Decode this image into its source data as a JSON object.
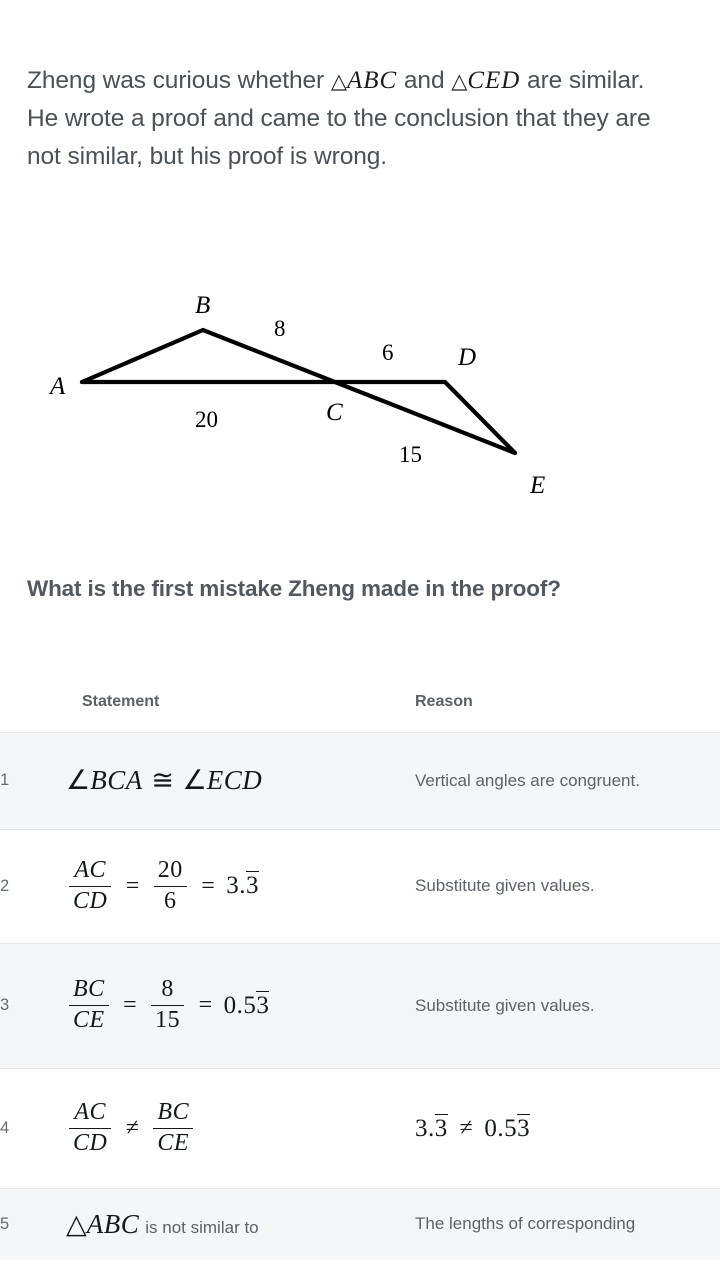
{
  "prompt": {
    "part1": "Zheng was curious whether ",
    "tri_abc": "△ABC",
    "part2": " and ",
    "tri_ced": "△CED",
    "part3": " are similar. He wrote a proof and came to the conclusion that they are not similar, but his proof is wrong."
  },
  "diagram": {
    "labels": {
      "A": "A",
      "B": "B",
      "C": "C",
      "D": "D",
      "E": "E"
    },
    "measures": {
      "ac": "20",
      "bc": "8",
      "cd": "6",
      "ce": "15"
    },
    "stroke_color": "#000000"
  },
  "question": "What is the first mistake Zheng made in the proof?",
  "table": {
    "headers": {
      "number": "",
      "statement": "Statement",
      "reason": "Reason"
    },
    "rows": [
      {
        "number": "1",
        "statement_text": "∠BCA ≅ ∠ECD",
        "statement_parts": {
          "angle1": "∠BCA",
          "congruent": "≅",
          "angle2": "∠ECD"
        },
        "reason": "Vertical angles are congruent."
      },
      {
        "number": "2",
        "statement_text": "AC/CD = 20/6 = 3.3̄",
        "statement_parts": {
          "frac1_top": "AC",
          "frac1_bot": "CD",
          "eq1": "=",
          "frac2_top": "20",
          "frac2_bot": "6",
          "eq2": "=",
          "value_lead": "3.",
          "value_repeat": "3"
        },
        "reason": "Substitute given values."
      },
      {
        "number": "3",
        "statement_text": "BC/CE = 8/15 = 0.53̄",
        "statement_parts": {
          "frac1_top": "BC",
          "frac1_bot": "CE",
          "eq1": "=",
          "frac2_top": "8",
          "frac2_bot": "15",
          "eq2": "=",
          "value_lead": "0.5",
          "value_repeat": "3"
        },
        "reason": "Substitute given values."
      },
      {
        "number": "4",
        "statement_text": "AC/CD ≠ BC/CE",
        "statement_parts": {
          "frac1_top": "AC",
          "frac1_bot": "CD",
          "op": "≠",
          "frac2_top": "BC",
          "frac2_bot": "CE"
        },
        "reason_parts": {
          "left_lead": "3.",
          "left_repeat": "3",
          "op": "≠",
          "right_lead": "0.5",
          "right_repeat": "3"
        },
        "reason": "3.3̄ ≠ 0.53̄"
      },
      {
        "number": "5",
        "statement_text": "△ABC is not similar to",
        "statement_parts": {
          "tri": "△ABC",
          "text": "is not similar to"
        },
        "reason": "The lengths of corresponding"
      }
    ]
  }
}
